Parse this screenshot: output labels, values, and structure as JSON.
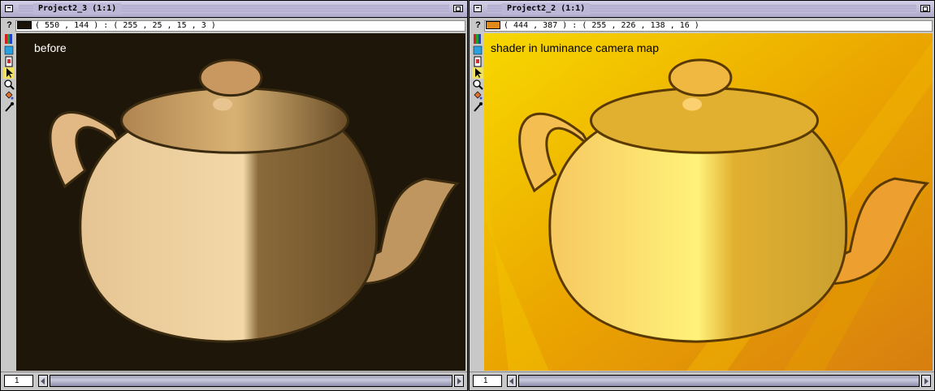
{
  "windows": [
    {
      "title": "Project2_3 (1:1)",
      "pixel_info": "( 550 , 144 ) : ( 255 , 25 , 15 , 3 )",
      "swatch_color": "#1a1208",
      "caption": "before",
      "page_number": "1"
    },
    {
      "title": "Project2_2 (1:1)",
      "pixel_info": "( 444 , 387 ) : ( 255 , 226 , 138 , 16 )",
      "swatch_color": "#e2891a",
      "caption": "shader in luminance camera map",
      "page_number": "1"
    }
  ],
  "tools": [
    "help-icon",
    "color-palette-icon",
    "color-swatch-icon",
    "document-icon",
    "arrow-pointer-icon",
    "magnifier-icon",
    "paint-bucket-icon",
    "eyedropper-icon"
  ],
  "colors": {
    "left_background": "#1e1609",
    "right_background": "#f2b200"
  }
}
